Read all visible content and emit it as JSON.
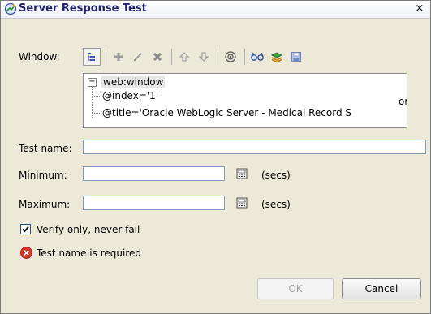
{
  "window": {
    "title": "Server Response Test",
    "close_label": "×"
  },
  "form": {
    "window_label": "Window:",
    "test_name_label": "Test name:",
    "test_name_value": "",
    "minimum_label": "Minimum:",
    "minimum_value": "",
    "maximum_label": "Maximum:",
    "maximum_value": "",
    "unit_label": "(secs)",
    "verify_label": "Verify only, never fail",
    "verify_checked": true,
    "error_message": "Test name is required"
  },
  "toolbar": {
    "icons": [
      "tree-view-icon",
      "add-icon",
      "edit-icon",
      "delete-icon",
      "move-up-icon",
      "move-down-icon",
      "target-icon",
      "find-icon",
      "library-icon",
      "save-icon"
    ]
  },
  "tree": {
    "root": "web:window",
    "children": [
      "@index='1'",
      "@title='Oracle WebLogic Server - Medical Record S"
    ],
    "or_text": "or"
  },
  "buttons": {
    "ok": "OK",
    "cancel": "Cancel"
  },
  "colors": {
    "dialog_bg": "#ece9d8",
    "error_red": "#d9342b",
    "title_text": "#1f1f6a"
  }
}
